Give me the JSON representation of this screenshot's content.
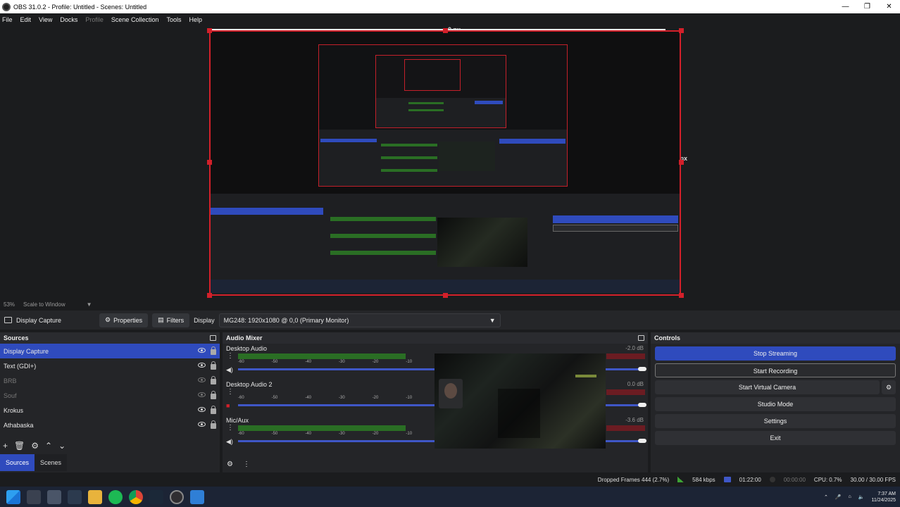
{
  "window": {
    "title": "OBS 31.0.2 - Profile: Untitled - Scenes: Untitled",
    "controls": {
      "minimize": "—",
      "maximize": "❐",
      "close": "✕"
    }
  },
  "menu": [
    {
      "label": "File",
      "enabled": true
    },
    {
      "label": "Edit",
      "enabled": true
    },
    {
      "label": "View",
      "enabled": true
    },
    {
      "label": "Docks",
      "enabled": true
    },
    {
      "label": "Profile",
      "enabled": false
    },
    {
      "label": "Scene Collection",
      "enabled": true
    },
    {
      "label": "Tools",
      "enabled": true
    },
    {
      "label": "Help",
      "enabled": true
    }
  ],
  "preview": {
    "top_label": "0 px",
    "right_label": "2 px",
    "zoom": "53%",
    "scale_mode": "Scale to Window"
  },
  "source_toolbar": {
    "selected_source": "Display Capture",
    "properties_label": "Properties",
    "filters_label": "Filters",
    "display_label": "Display",
    "display_value": "MG248: 1920x1080 @ 0,0 (Primary Monitor)"
  },
  "sources": {
    "title": "Sources",
    "items": [
      {
        "name": "Display Capture",
        "visible": true,
        "selected": true
      },
      {
        "name": "Text (GDI+)",
        "visible": true,
        "selected": false
      },
      {
        "name": "BRB",
        "visible": false,
        "selected": false
      },
      {
        "name": "Souf",
        "visible": false,
        "selected": false
      },
      {
        "name": "Krokus",
        "visible": true,
        "selected": false
      },
      {
        "name": "Athabaska",
        "visible": true,
        "selected": false
      }
    ],
    "tabs": [
      "Sources",
      "Scenes"
    ]
  },
  "mixer": {
    "title": "Audio Mixer",
    "ticks": [
      "-60",
      "-55",
      "-50",
      "-45",
      "-40",
      "-35",
      "-30",
      "-25",
      "-20",
      "-15",
      "-10",
      "-5",
      "0"
    ],
    "channels": [
      {
        "name": "Desktop Audio",
        "db": "-2.0 dB",
        "level": 0.82,
        "volume": 1.0,
        "muted": false
      },
      {
        "name": "Desktop Audio 2",
        "db": "0.0 dB",
        "level": 0.0,
        "volume": 1.0,
        "muted": true
      },
      {
        "name": "Mic/Aux",
        "db": "-3.6 dB",
        "level": 0.82,
        "volume": 1.0,
        "muted": false
      }
    ]
  },
  "controls": {
    "title": "Controls",
    "buttons": [
      "Stop Streaming",
      "Start Recording",
      "Start Virtual Camera",
      "Studio Mode",
      "Settings",
      "Exit"
    ]
  },
  "status": {
    "dropped_frames": "Dropped Frames 444 (2.7%)",
    "bitrate": "584 kbps",
    "stream_time": "01:22:00",
    "record_time": "00:00:00",
    "cpu": "CPU: 0.7%",
    "fps": "30.00 / 30.00 FPS"
  },
  "taskbar": {
    "time": "7:37 AM",
    "date": "11/24/2025"
  },
  "colors": {
    "accent": "#2f4bbd",
    "selection_border": "#d3202a",
    "meter_green": "#2a6e24",
    "meter_red": "#6b1c22"
  }
}
